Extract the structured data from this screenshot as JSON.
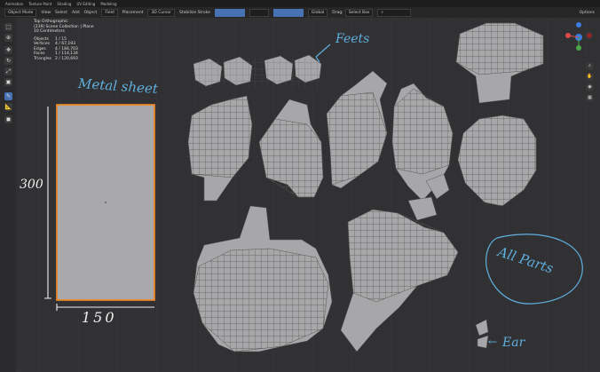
{
  "topbar": {
    "items": [
      "Animation",
      "Texture Paint",
      "Shading",
      "UV Editing",
      "Modeling"
    ]
  },
  "toolbar": {
    "mode": "Object Mode",
    "menus": [
      "View",
      "Select",
      "Add",
      "Object"
    ],
    "transform_pivot": "Global",
    "snap": "Field",
    "placement": "Placement",
    "cursor": "3D Cursor",
    "stroke": "Stabilize Stroke",
    "drag": "Drag:",
    "select_box": "Select Box",
    "options": "Options"
  },
  "viewport": {
    "title": "Top Orthographic",
    "collection": "(239) Scene Collection | Plane",
    "unit": "10 Centimeters",
    "stats": [
      {
        "label": "Objects",
        "value": "1 / 15"
      },
      {
        "label": "Vertices",
        "value": "4 / 67,193"
      },
      {
        "label": "Edges",
        "value": "4 / 184,703"
      },
      {
        "label": "Faces",
        "value": "1 / 114,134"
      },
      {
        "label": "Triangles",
        "value": "2 / 120,693"
      }
    ]
  },
  "annotations": {
    "metal_sheet": "Metal sheet",
    "height": "300",
    "width": "150",
    "feets": "Feets",
    "all_parts": "All Parts",
    "ear": "Ear"
  },
  "colors": {
    "background": "#313133",
    "parts": "#a7a7a9",
    "sheet_outline": "#e8862a",
    "annotation_blue": "#5fb0e0",
    "accent": "#4772b3"
  }
}
